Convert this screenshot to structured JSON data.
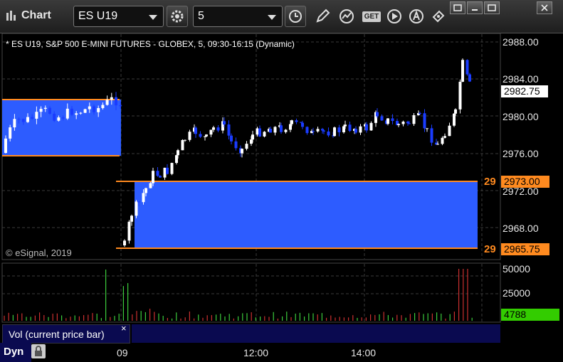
{
  "toolbar": {
    "title": "Chart",
    "symbol": "ES U19",
    "interval": "5",
    "icons": [
      "settings-gear-icon",
      "clock-icon",
      "pencil-icon",
      "chart-type-icon",
      "get-data-icon",
      "play-icon",
      "alert-icon",
      "share-icon"
    ],
    "get_label": "GET"
  },
  "window": {
    "icons": [
      "link-icon",
      "restore-icon",
      "maximize-icon",
      "close-icon"
    ]
  },
  "chart": {
    "header": "* ES U19, S&P 500 E-MINI FUTURES - GLOBEX, 5, 09:30-16:15 (Dynamic)",
    "watermark": "© eSignal, 2019",
    "price_axis": [
      "2988.00",
      "2984.00",
      "2980.00",
      "2976.00",
      "2972.00",
      "2968.00"
    ],
    "current_price": "2982.75",
    "level_upper": "2973.00",
    "level_lower": "2965.75",
    "level_marker": "29",
    "volume_axis": [
      "50000",
      "25000",
      "0"
    ],
    "volume_current": "4788",
    "time_axis": [
      "09",
      "12:00",
      "14:00"
    ],
    "colors": {
      "band": "#2d5cff",
      "level_line": "#ff8a1f",
      "up_bar": "#ffffff",
      "down_bar": "#1a3cff",
      "vol_up": "#3ccc3c",
      "vol_down": "#cc3030",
      "current_tag": "#ffffff",
      "level_tag": "#ff8a1f",
      "vol_tag": "#33cc00"
    }
  },
  "volume_panel": {
    "label": "Vol (current price bar)",
    "close": "×"
  },
  "status": {
    "dyn": "Dyn"
  }
}
